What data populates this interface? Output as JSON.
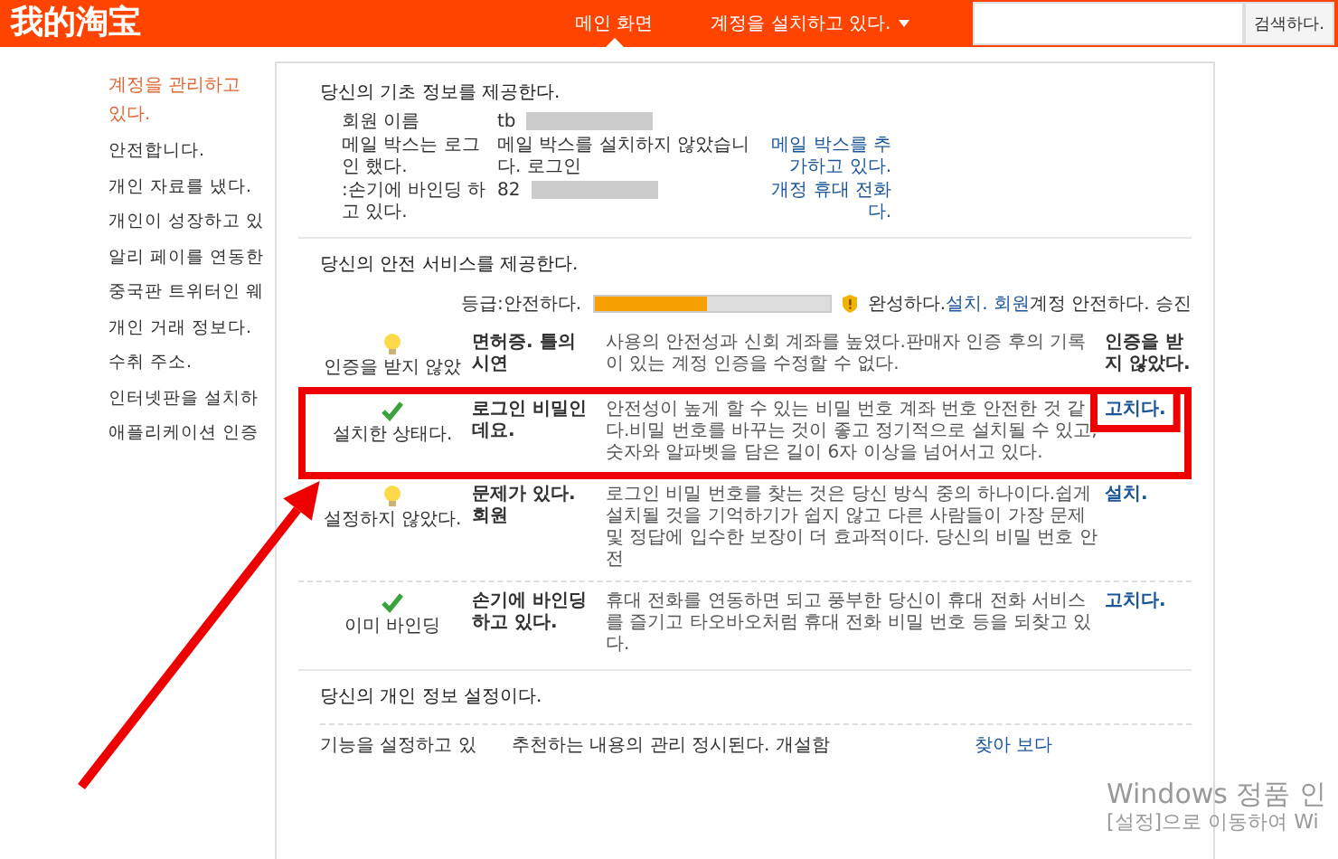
{
  "header": {
    "logo": "我的淘宝",
    "tabs": [
      {
        "label": "메인 화면",
        "selected": true,
        "dropdown": false
      },
      {
        "label": "계정을 설치하고 있다.",
        "selected": false,
        "dropdown": true
      }
    ],
    "search": {
      "button": "검색하다."
    }
  },
  "sidebar": {
    "title": "계정을 관리하고 있다.",
    "items": [
      "안전합니다.",
      "개인 자료를 냈다.",
      "개인이 성장하고 있",
      "알리 페이를 연동한",
      "중국판 트위터인 웨",
      "개인 거래 정보다.",
      "수취 주소.",
      "인터넷판을 설치하",
      "애플리케이션 인증"
    ]
  },
  "basic_info": {
    "heading": "당신의 기초 정보를 제공한다.",
    "rows": [
      {
        "label": "회원 이름",
        "value": "tb",
        "redacted": true
      },
      {
        "label": "메일 박스는 로그인 했다.",
        "value": "메일 박스를 설치하지 않았습니다. 로그인",
        "redacted": false,
        "link": "메일 박스를 추가하고 있다."
      },
      {
        "label": ":손기에 바인딩 하고 있다.",
        "value": "82",
        "redacted": true,
        "link": "개정 휴대 전화다."
      }
    ]
  },
  "security": {
    "heading": "당신의 안전 서비스를 제공한다.",
    "grade": {
      "label": "등급:안전하다.",
      "level": 0.48,
      "note_prefix": "완성하다.",
      "links": [
        "설치.",
        "회원"
      ],
      "note_suffix": "계정 안전하다. 승진"
    },
    "items": [
      {
        "kind": "warn",
        "status_text": "인증을 받지 않았",
        "title": "면허증. 틀의 시연",
        "description": "사용의 안전성과 신회 계좌를 높였다.판매자 인증 후의 기록이 있는 계정 인증을 수정할 수 없다.",
        "action": {
          "label": "인증을 받지 않았다.",
          "kind": "text"
        }
      },
      {
        "kind": "ok",
        "status_text": "설치한 상태다.",
        "title": "로그인 비밀인데요.",
        "description": "안전성이 높게 할 수 있는 비밀 번호 계좌 번호 안전한 것 같다.비밀 번호를 바꾸는 것이 좋고 정기적으로 설치될 수 있고, 숫자와 알파벳을 담은 길이 6자 이상을 넘어서고 있다.",
        "action": {
          "label": "고치다.",
          "kind": "link"
        }
      },
      {
        "kind": "warn",
        "status_text": "설정하지 않았다.",
        "title": "문제가 있다. 회원",
        "description": "로그인 비밀 번호를 찾는 것은 당신 방식 중의 하나이다.쉽게 설치될 것을 기억하기가 쉽지 않고 다른 사람들이 가장 문제 및 정답에 입수한 보장이 더 효과적이다. 당신의 비밀 번호 안전",
        "action": {
          "label": "설치.",
          "kind": "link"
        }
      },
      {
        "kind": "ok",
        "status_text": "이미 바인딩",
        "title": "손기에 바인딩 하고 있다.",
        "description": "휴대 전화를 연동하면 되고 풍부한 당신이 휴대 전화 서비스를 즐기고 타오바오처럼 휴대 전화 비밀 번호 등을 되찾고 있다.",
        "action": {
          "label": "고치다.",
          "kind": "link"
        }
      }
    ]
  },
  "personal": {
    "heading": "당신의 개인 정보 설정이다.",
    "rows": [
      {
        "label": "기능을 설정하고 있",
        "description": "추천하는 내용의 관리 정시된다. 개설함",
        "link": "찾아 보다"
      }
    ]
  },
  "os_notice": {
    "title": "Windows 정품 인",
    "subtitle": "[설정]으로 이동하여 Wi"
  }
}
